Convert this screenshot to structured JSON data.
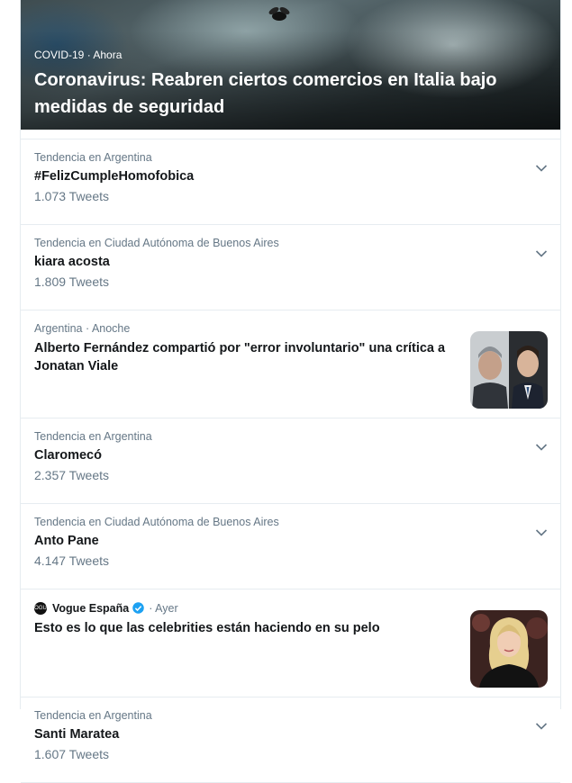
{
  "hero": {
    "category": "COVID-19",
    "time": "Ahora",
    "headline": "Coronavirus: Reabren ciertos comercios en Italia bajo medidas de seguridad"
  },
  "items": [
    {
      "type": "trend",
      "context": "Tendencia en Argentina",
      "name": "#FelizCumpleHomofobica",
      "count": "1.073 Tweets",
      "icon": "chevron-down-icon"
    },
    {
      "type": "trend",
      "context": "Tendencia en Ciudad Autónoma de Buenos Aires",
      "name": "kiara acosta",
      "count": "1.809 Tweets",
      "icon": "chevron-down-icon"
    },
    {
      "type": "news",
      "context_region": "Argentina",
      "context_time": "Anoche",
      "headline": "Alberto Fernández compartió por \"error involuntario\" una crítica a Jonatan Viale",
      "image": "two-men-portrait-thumbnail"
    },
    {
      "type": "trend",
      "context": "Tendencia en Argentina",
      "name": "Claromecó",
      "count": "2.357 Tweets",
      "icon": "chevron-down-icon"
    },
    {
      "type": "trend",
      "context": "Tendencia en Ciudad Autónoma de Buenos Aires",
      "name": "Anto Pane",
      "count": "4.147 Tweets",
      "icon": "chevron-down-icon"
    },
    {
      "type": "news",
      "source": "Vogue España",
      "source_logo_text": "VOGUE",
      "verified": true,
      "time": "Ayer",
      "headline": "Esto es lo que las celebrities están haciendo en su pelo",
      "image": "celebrity-blonde-thumbnail"
    },
    {
      "type": "trend",
      "context": "Tendencia en Argentina",
      "name": "Santi Maratea",
      "count": "1.607 Tweets",
      "icon": "chevron-down-icon"
    }
  ],
  "colors": {
    "secondary_text": "#657786",
    "primary_text": "#14171a",
    "verified": "#1da1f2",
    "divider": "#e6ecf0"
  }
}
